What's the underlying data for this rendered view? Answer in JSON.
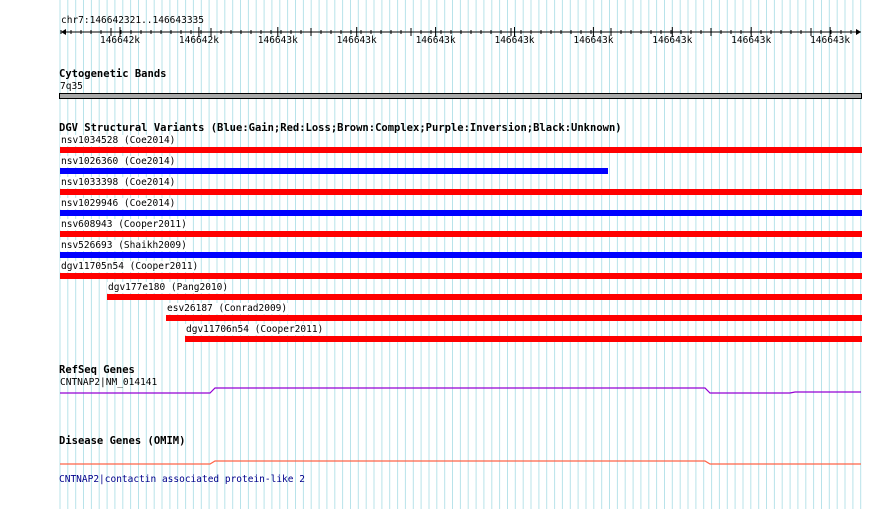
{
  "ruler": {
    "locus": "chr7:146642321..146643335",
    "ticks": [
      "146642k",
      "146642k",
      "146643k",
      "146643k",
      "146643k",
      "146643k",
      "146643k",
      "146643k",
      "146643k",
      "146643k"
    ]
  },
  "cytoband": {
    "title": "Cytogenetic Bands",
    "band": "7q35",
    "color": "#a9a9a9"
  },
  "dgv": {
    "title": "DGV Structural Variants (Blue:Gain;Red:Loss;Brown:Complex;Purple:Inversion;Black:Unknown)",
    "items": [
      {
        "label": "nsv1034528 (Coe2014)",
        "type": "Loss",
        "color": "#ff0000"
      },
      {
        "label": "nsv1026360 (Coe2014)",
        "type": "Gain",
        "color": "#0000ff"
      },
      {
        "label": "nsv1033398 (Coe2014)",
        "type": "Loss",
        "color": "#ff0000"
      },
      {
        "label": "nsv1029946 (Coe2014)",
        "type": "Gain",
        "color": "#0000ff"
      },
      {
        "label": "nsv608943 (Cooper2011)",
        "type": "Loss",
        "color": "#ff0000"
      },
      {
        "label": "nsv526693 (Shaikh2009)",
        "type": "Gain",
        "color": "#0000ff"
      },
      {
        "label": "dgv11705n54 (Cooper2011)",
        "type": "Loss",
        "color": "#ff0000"
      },
      {
        "label": "dgv177e180 (Pang2010)",
        "type": "Loss",
        "color": "#ff0000"
      },
      {
        "label": "esv26187 (Conrad2009)",
        "type": "Loss",
        "color": "#ff0000"
      },
      {
        "label": "dgv11706n54 (Cooper2011)",
        "type": "Loss",
        "color": "#ff0000"
      }
    ]
  },
  "refseq": {
    "title": "RefSeq Genes",
    "gene": "CNTNAP2|NM_014141",
    "color": "#9400d3"
  },
  "disease": {
    "title": "Disease Genes (OMIM)",
    "gene": "CNTNAP2|contactin associated protein-like 2",
    "color": "#ff6347",
    "text_color": "#00008b"
  }
}
